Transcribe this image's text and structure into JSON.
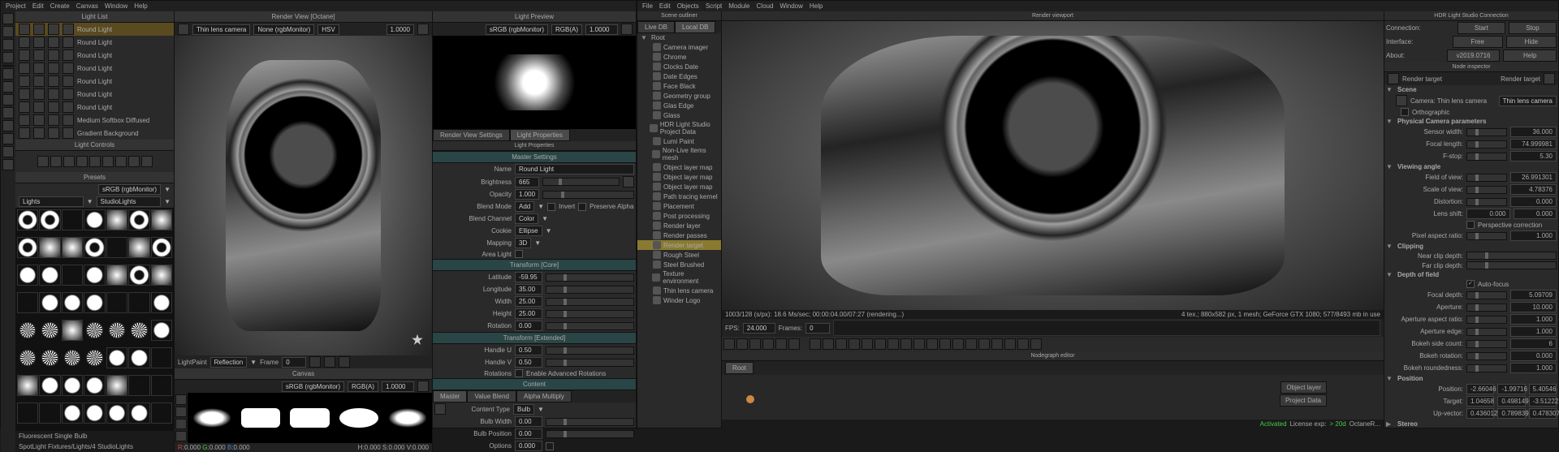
{
  "app1_menu": [
    "Project",
    "Edit",
    "Create",
    "Canvas",
    "Window",
    "Help"
  ],
  "app2_menu": [
    "File",
    "Edit",
    "Objects",
    "Script",
    "Module",
    "Cloud",
    "Window",
    "Help"
  ],
  "light_list_title": "Light List",
  "lights": [
    "Round Light",
    "Round Light",
    "Round Light",
    "Round Light",
    "Round Light",
    "Round Light",
    "Round Light",
    "Medium Softbox Diffused",
    "Gradient Background"
  ],
  "light_controls_title": "Light Controls",
  "presets_title": "Presets",
  "presets_dropdown_l": "Lights",
  "presets_dropdown_r": "StudioLights",
  "colorspace": "sRGB (rgbMonitor)",
  "preset_footer_1": "Fluorescent Single Bulb",
  "preset_footer_2": "SpotLight Fixtures/Lights/4 StudioLights",
  "render_title": "Render View [Octane]",
  "render_cam": "Thin lens camera",
  "render_disp": "None (rgbMonitor)",
  "render_mode": "HSV",
  "render_exposure": "1.0000",
  "lp_label": "LightPaint",
  "lp_dropdown": "Reflection",
  "lp_frame_label": "Frame",
  "lp_frame": "0",
  "canvas_title": "Canvas",
  "canvas_cs": "sRGB (rgbMonitor)",
  "canvas_cs2": "RGB(A)",
  "canvas_val": "1.0000",
  "canvas_footer_l": "R:0.000 G:0.000 B:0.000",
  "canvas_footer_r": "H:0.000 S:0.000 V:0.000",
  "preview_title": "Light Preview",
  "preview_cs": "sRGB (rgbMonitor)",
  "preview_cs2": "RGB(A)",
  "preview_val": "1.0000",
  "tabs_rvs": "Render View Settings",
  "tabs_lp": "Light Properties",
  "lp_header": "Light Properties",
  "ms_header": "Master Settings",
  "fields": {
    "name_l": "Name",
    "name_v": "Round Light",
    "brightness_l": "Brightness",
    "brightness_v": "665",
    "opacity_l": "Opacity",
    "opacity_v": "1.000",
    "blend_l": "Blend Mode",
    "blend_v": "Add",
    "invert": "Invert",
    "preserve": "Preserve Alpha",
    "bch_l": "Blend Channel",
    "bch_v": "Color",
    "cookie_l": "Cookie",
    "cookie_v": "Ellipse",
    "map_l": "Mapping",
    "map_v": "3D",
    "area_l": "Area Light"
  },
  "xform_core": "Transform [Core]",
  "xform": {
    "lat_l": "Latitude",
    "lat_v": "-59.95",
    "lon_l": "Longitude",
    "lon_v": "35.00",
    "w_l": "Width",
    "w_v": "25.00",
    "h_l": "Height",
    "h_v": "25.00",
    "rot_l": "Rotation",
    "rot_v": "0.00"
  },
  "xform_ext": "Transform [Extended]",
  "handles": {
    "hu_l": "Handle U",
    "hu_v": "0.50",
    "hv_l": "Handle V",
    "hv_v": "0.50",
    "rots_l": "Rotations",
    "rots_v": "Enable Advanced Rotations"
  },
  "content_title": "Content",
  "content_tabs": [
    "Master",
    "Value Blend",
    "Alpha Multiply"
  ],
  "content": {
    "ct_l": "Content Type",
    "ct_v": "Bulb",
    "bw_l": "Bulb Width",
    "bw_v": "0.00",
    "bp_l": "Bulb Position",
    "bp_v": "0.00",
    "opt_l": "Options",
    "opt_v": "0.000"
  },
  "scene_outliner": "Scene outliner",
  "scene_tabs": [
    "Live DB",
    "Local DB"
  ],
  "scene_root": "Root",
  "scene_tree": [
    "Camera imager",
    "Chrome",
    "Clocks Date",
    "Date Edges",
    "Face Black",
    "Geometry group",
    "Glas Edge",
    "Glass",
    "HDR Light Studio Project Data",
    "Lumi Paint",
    "Non-Live Items mesh",
    "Object layer map",
    "Object layer map",
    "Object layer map",
    "Path tracing kernel",
    "Placement",
    "Post processing",
    "Render layer",
    "Render passes",
    "Render target",
    "Rough Steel",
    "Steel Brushed",
    "Texture environment",
    "Thin lens camera",
    "Winder Logo"
  ],
  "scene_selected": "Render target",
  "render_viewport_title": "Render viewport",
  "rv_stats_l": "1003/128 (s/px): 18.6 Ms/sec; 00:00:04.00/07:27 (rendering...)",
  "rv_stats_r": "4 tex.; 880x582 px, 1 mesh; GeForce GTX 1080; 577/8493 mb in use",
  "fps_l": "FPS:",
  "fps_v": "24.000",
  "frames_l": "Frames:",
  "frames_v": "0",
  "nodegraph_title": "Nodegraph editor",
  "ng_crumb": "Root",
  "ng_n1": "Object layer",
  "ng_n2": "Project Data",
  "hdr_conn_title": "HDR Light Studio Connection",
  "hdr_conn": {
    "connection_l": "Connection:",
    "start": "Start",
    "stop": "Stop",
    "interface_l": "Interface:",
    "free": "Free",
    "hide": "Hide",
    "about_l": "About:",
    "ver": "v2019.0716",
    "help": "Help"
  },
  "node_insp_title": "Node inspector",
  "ni_header": "Render target",
  "ni_right": "Render target",
  "ni_scene": "Scene",
  "ni_cam_l": "Camera: Thin lens camera",
  "ni_cam_r": "Thin lens camera",
  "ortho": "Orthographic",
  "phys_cam": "Physical Camera parameters",
  "ni": {
    "sensor_l": "Sensor width:",
    "sensor_v": "36.000",
    "focal_l": "Focal length:",
    "focal_v": "74.999981",
    "fstop_l": "F-stop:",
    "fstop_v": "5.30",
    "view_ang": "Viewing angle",
    "fov_l": "Field of view:",
    "fov_v": "26.991301",
    "sov_l": "Scale of view:",
    "sov_v": "4.78376",
    "dist_l": "Distortion:",
    "dist_v": "0.000",
    "lens_l": "Lens shift:",
    "lens_v1": "0.000",
    "lens_v2": "0.000",
    "persp_l": "Perspective correction",
    "par_l": "Pixel aspect ratio:",
    "par_v": "1.000",
    "clip": "Clipping",
    "near_l": "Near clip depth:",
    "far_l": "Far clip depth:",
    "dof": "Depth of field",
    "auto_l": "Auto-focus",
    "fd_l": "Focal depth:",
    "fd_v": "5.09709",
    "ap_l": "Aperture:",
    "ap_v": "10.000",
    "apar_l": "Aperture aspect ratio:",
    "apar_v": "1.000",
    "apedge_l": "Aperture edge:",
    "apedge_v": "1.000",
    "bsc_l": "Bokeh side count:",
    "bsc_v": "6",
    "brot_l": "Bokeh rotation:",
    "brot_v": "0.000",
    "brnd_l": "Bokeh roundedness:",
    "brnd_v": "1.000",
    "pos": "Position",
    "pos_l": "Position:",
    "pos1": "-2.66046",
    "pos2": "-1.99716",
    "pos3": "5.40546",
    "tgt_l": "Target:",
    "tgt1": "1.04658",
    "tgt2": "0.498149",
    "tgt3": "-3.51222",
    "up_l": "Up-vector:",
    "up1": "0.436012",
    "up2": "0.789839",
    "up3": "0.478307",
    "stereo": "Stereo"
  },
  "statusbar": {
    "activated": "Activated",
    "license": "License exp:",
    "days": "> 20d",
    "render": "OctaneR..."
  }
}
